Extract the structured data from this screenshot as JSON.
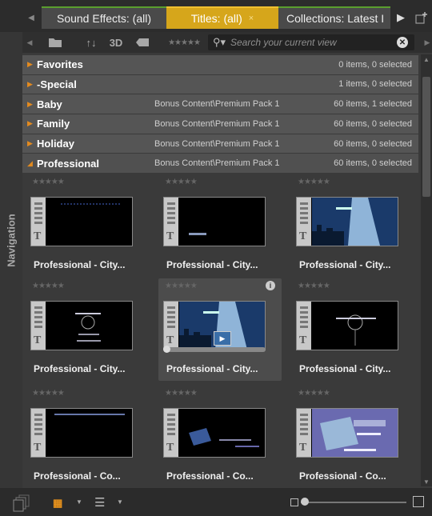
{
  "nav": {
    "label": "Navigation"
  },
  "tabs": [
    {
      "label": "Sound Effects: (all)"
    },
    {
      "label": "Titles: (all)",
      "close": "×"
    },
    {
      "label": "Collections: Latest I"
    }
  ],
  "toolbar": {
    "sort_label": "↑↓",
    "three_d_label": "3D",
    "rating_stars": "★★★★★",
    "search": {
      "placeholder": "Search your current view",
      "value": ""
    }
  },
  "categories": [
    {
      "name": "Favorites",
      "path": "",
      "count": "0 items, 0 selected",
      "expanded": false
    },
    {
      "name": "-Special",
      "path": "",
      "count": "1 items, 0 selected",
      "expanded": false
    },
    {
      "name": "Baby",
      "path": "Bonus Content\\Premium Pack 1",
      "count": "60 items, 1 selected",
      "expanded": false
    },
    {
      "name": "Family",
      "path": "Bonus Content\\Premium Pack 1",
      "count": "60 items, 0 selected",
      "expanded": false
    },
    {
      "name": "Holiday",
      "path": "Bonus Content\\Premium Pack 1",
      "count": "60 items, 0 selected",
      "expanded": false
    },
    {
      "name": "Professional",
      "path": "Bonus Content\\Premium Pack 1",
      "count": "60 items, 0 selected",
      "expanded": true
    }
  ],
  "tiles": [
    {
      "label": "Professional - City...",
      "stars": "★★★★★",
      "style": "dark-lines"
    },
    {
      "label": "Professional - City...",
      "stars": "★★★★★",
      "style": "dark-small"
    },
    {
      "label": "Professional - City...",
      "stars": "★★★★★",
      "style": "city-blue"
    },
    {
      "label": "Professional - City...",
      "stars": "★★★★★",
      "style": "dark-wire"
    },
    {
      "label": "Professional - City...",
      "stars": "★★★★★",
      "style": "city-blue",
      "selected": true,
      "info": "i"
    },
    {
      "label": "Professional - City...",
      "stars": "★★★★★",
      "style": "dark-wire-2"
    },
    {
      "label": "Professional - Co...",
      "stars": "★★★★★",
      "style": "dark-line-top"
    },
    {
      "label": "Professional - Co...",
      "stars": "★★★★★",
      "style": "dark-laptop"
    },
    {
      "label": "Professional - Co...",
      "stars": "★★★★★",
      "style": "purple-laptop"
    }
  ],
  "colors": {
    "accent_tab": "#d6a61b",
    "expand_arrow": "#e28a1f",
    "tab_top_green": "#5a9e2e"
  },
  "icons": {
    "folder": "folder-icon",
    "sort": "sort-icon",
    "tag": "tag-icon",
    "search": "search-icon",
    "clear": "clear-search-icon"
  }
}
